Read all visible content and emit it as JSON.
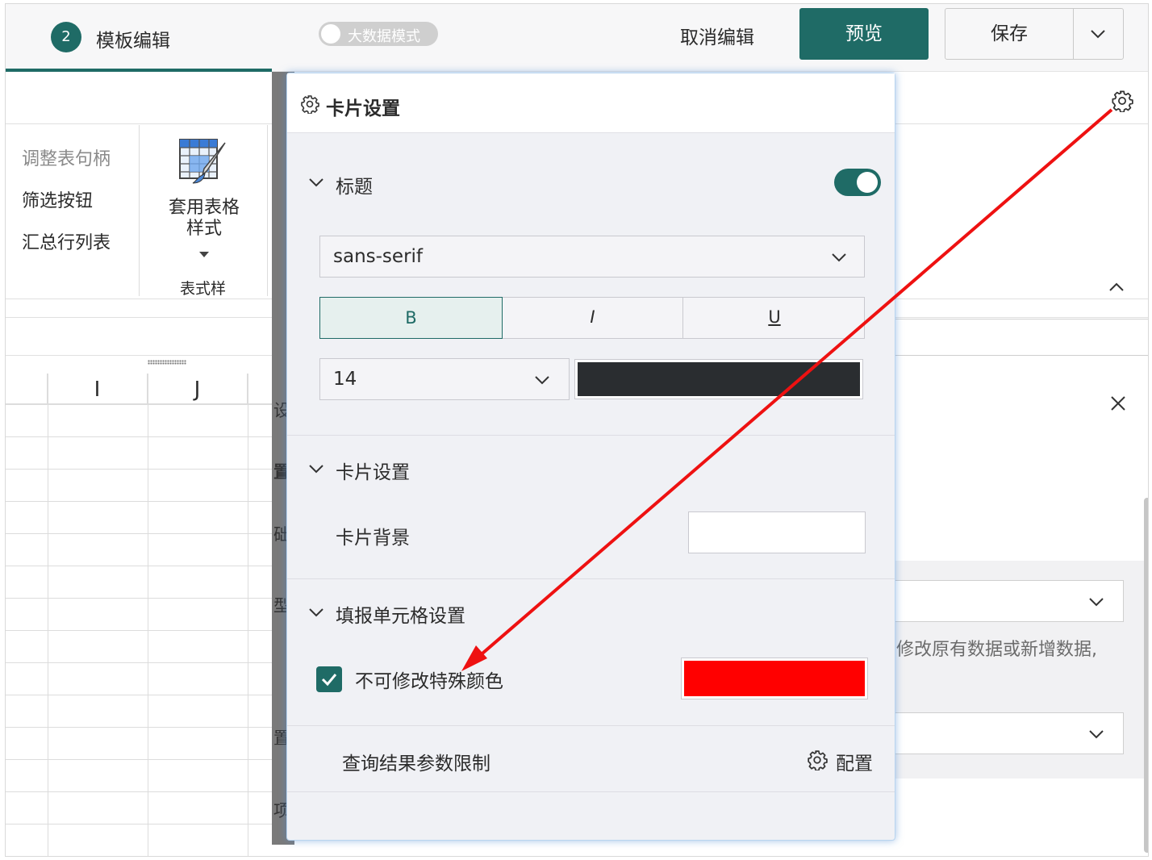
{
  "topbar": {
    "step_number": "2",
    "step_label": "模板编辑",
    "big_data_mode": "大数据模式",
    "cancel_edit": "取消编辑",
    "preview": "预览",
    "save": "保存"
  },
  "tools": {
    "items": [
      "调整表句柄",
      "筛选按钮",
      "汇总行列表"
    ],
    "apply_style": "套用表格样式",
    "style_caption": "表式样"
  },
  "grid": {
    "columns": [
      "I",
      "J"
    ]
  },
  "side_fragments": [
    "设",
    "置",
    "础",
    "型",
    "置",
    "项"
  ],
  "right": {
    "note": "修改原有数据或新增数据,"
  },
  "popup": {
    "title": "卡片设置",
    "title_section": {
      "label": "标题",
      "enabled": true,
      "font_family": "sans-serif",
      "bold_label": "B",
      "italic_label": "I",
      "underline_label": "U",
      "active_style": "bold",
      "font_size": "14",
      "text_color": "#2a2d30"
    },
    "card_section": {
      "label": "卡片设置",
      "bg_label": "卡片背景",
      "bg_color": "#ffffff"
    },
    "fill_section": {
      "label": "填报单元格设置",
      "checkbox_label": "不可修改特殊颜色",
      "checked": true,
      "special_color": "#ff0000"
    },
    "query_limit_label": "查询结果参数限制",
    "config_label": "配置"
  },
  "colors": {
    "accent": "#1f6b66",
    "annotation_arrow": "#ee1111"
  }
}
